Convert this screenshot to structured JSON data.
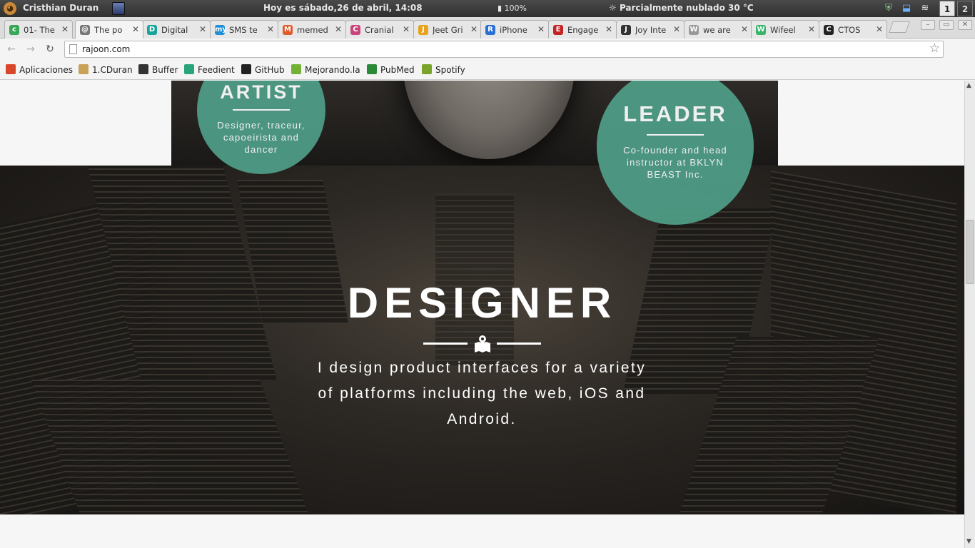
{
  "system_bar": {
    "user": "Cristhian Duran",
    "clock": "Hoy es sábado,26 de abril, 14:08",
    "battery": "100%",
    "weather": "Parcialmente nublado 30 °C",
    "workspaces": [
      "1",
      "2"
    ]
  },
  "tabs": [
    {
      "title": "01- The",
      "color": "#3aa657",
      "icon": "c"
    },
    {
      "title": "The po",
      "color": "#777777",
      "icon": "@"
    },
    {
      "title": "Digital",
      "color": "#1aa39a",
      "icon": "D"
    },
    {
      "title": "SMS te",
      "color": "#1e8fd8",
      "icon": "my"
    },
    {
      "title": "memed",
      "color": "#e05a2a",
      "icon": "M"
    },
    {
      "title": "Cranial",
      "color": "#c9457a",
      "icon": "C"
    },
    {
      "title": "Jeet Gri",
      "color": "#e8a21e",
      "icon": "J"
    },
    {
      "title": "iPhone",
      "color": "#2a6fd3",
      "icon": "R"
    },
    {
      "title": "Engage",
      "color": "#c42323",
      "icon": "E"
    },
    {
      "title": "Joy Inte",
      "color": "#333333",
      "icon": "J"
    },
    {
      "title": "we are",
      "color": "#999999",
      "icon": "W"
    },
    {
      "title": "Wifeel",
      "color": "#39b56a",
      "icon": "W"
    },
    {
      "title": "CTOS",
      "color": "#222222",
      "icon": "C"
    }
  ],
  "active_tab_index": 1,
  "address_bar": {
    "url": "rajoon.com"
  },
  "bookmarks": [
    {
      "label": "Aplicaciones",
      "color": "#d9472b"
    },
    {
      "label": "1.CDuran",
      "color": "#c9a25a"
    },
    {
      "label": "Buffer",
      "color": "#333333"
    },
    {
      "label": "Feedient",
      "color": "#2aa47a"
    },
    {
      "label": "GitHub",
      "color": "#222222"
    },
    {
      "label": "Mejorando.la",
      "color": "#74b236"
    },
    {
      "label": "PubMed",
      "color": "#2a8a3a"
    },
    {
      "label": "Spotify",
      "color": "#7aa329"
    }
  ],
  "page": {
    "artist_circle": {
      "title": "ARTIST",
      "text": "Designer, traceur, capoeirista and dancer"
    },
    "leader_circle": {
      "title": "LEADER",
      "text": "Co-founder and head instructor at BKLYN BEAST Inc."
    },
    "hero": {
      "title": "DESIGNER",
      "text": "I design product interfaces for a variety of platforms including the web, iOS and Android."
    },
    "accent_color": "#4f9e88"
  }
}
